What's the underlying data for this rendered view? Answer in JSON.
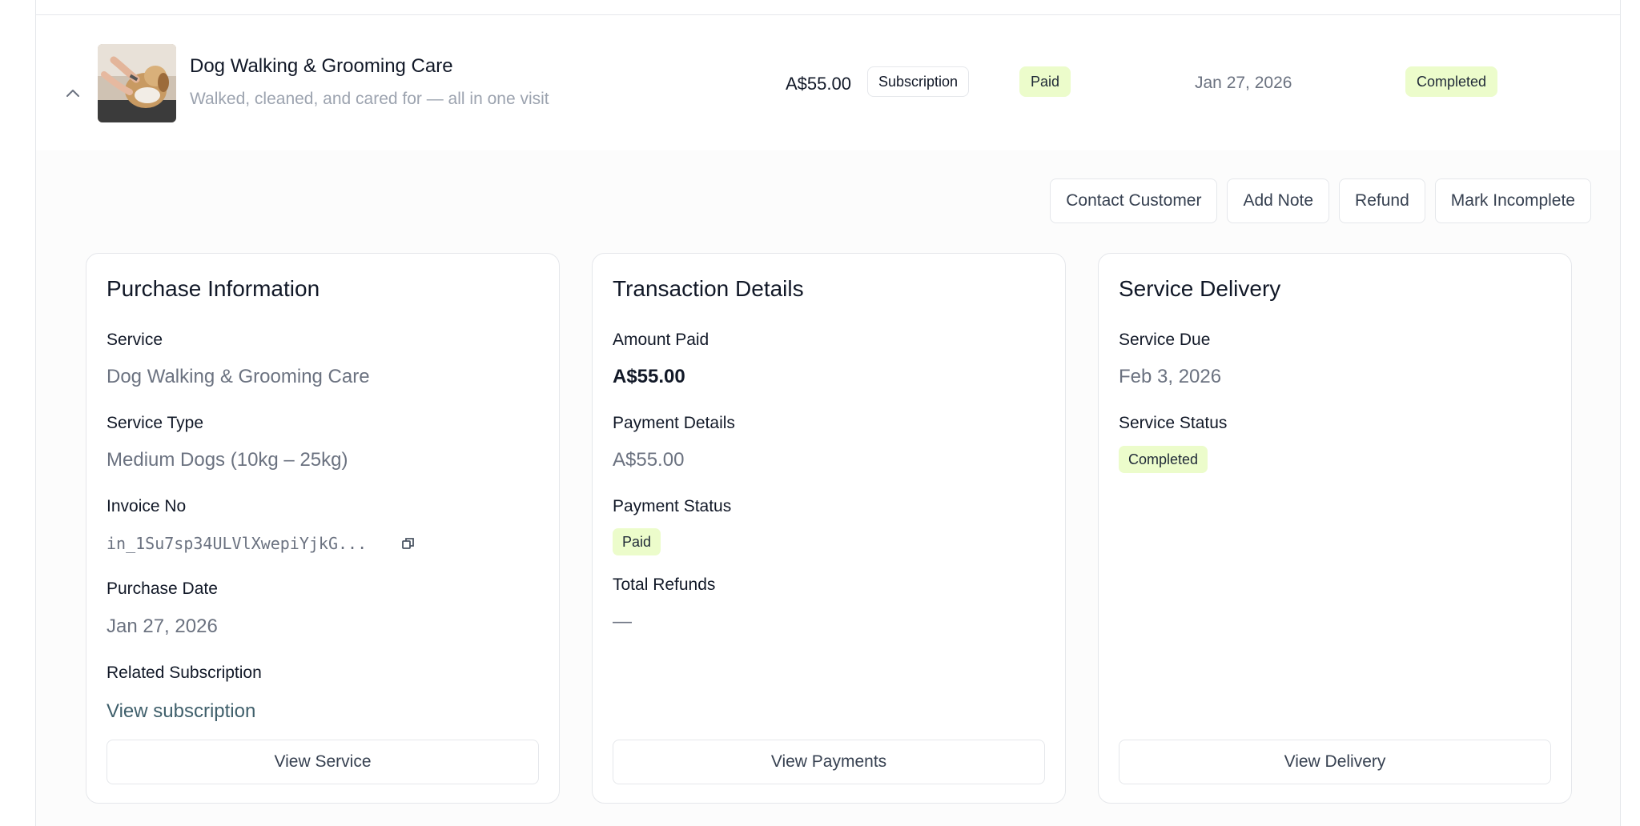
{
  "row": {
    "title": "Dog Walking & Grooming Care",
    "subtitle": "Walked, cleaned, and cared for — all in one visit",
    "price": "A$55.00",
    "type_badge": "Subscription",
    "payment_badge": "Paid",
    "date": "Jan 27, 2026",
    "status_badge": "Completed"
  },
  "actions": {
    "contact": "Contact Customer",
    "note": "Add Note",
    "refund": "Refund",
    "incomplete": "Mark Incomplete"
  },
  "purchase": {
    "title": "Purchase Information",
    "service_label": "Service",
    "service_value": "Dog Walking & Grooming Care",
    "type_label": "Service Type",
    "type_value": "Medium Dogs (10kg – 25kg)",
    "invoice_label": "Invoice No",
    "invoice_value": "in_1Su7sp34ULVlXwepiYjkG...",
    "date_label": "Purchase Date",
    "date_value": "Jan 27, 2026",
    "subscription_label": "Related Subscription",
    "subscription_link": "View subscription",
    "button": "View Service"
  },
  "transaction": {
    "title": "Transaction Details",
    "amount_label": "Amount Paid",
    "amount_value": "A$55.00",
    "details_label": "Payment Details",
    "details_value": "A$55.00",
    "status_label": "Payment Status",
    "status_badge": "Paid",
    "refunds_label": "Total Refunds",
    "refunds_value": "—",
    "button": "View Payments"
  },
  "delivery": {
    "title": "Service Delivery",
    "due_label": "Service Due",
    "due_value": "Feb 3, 2026",
    "status_label": "Service Status",
    "status_badge": "Completed",
    "button": "View Delivery"
  },
  "colors": {
    "badge_bg": "#ecfccb",
    "link": "#3f5f6b",
    "border": "#e5e7eb",
    "muted": "#6b7280"
  },
  "icons": {
    "expand": "chevron-up-icon",
    "copy": "copy-icon"
  }
}
